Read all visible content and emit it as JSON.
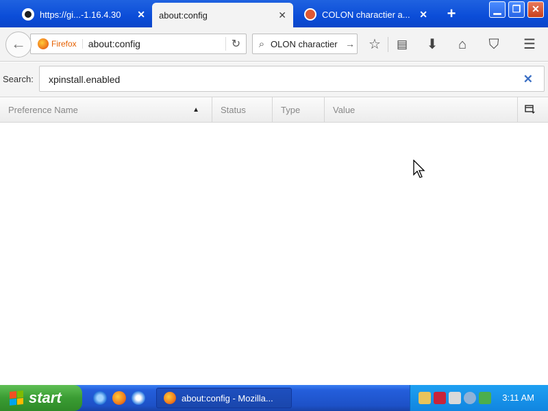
{
  "tabs": [
    {
      "label": "https://gi...-1.16.4.30",
      "icon": "github-icon",
      "close": "✕"
    },
    {
      "label": "about:config",
      "close": "✕"
    },
    {
      "label": "COLON charactier a...",
      "icon": "duckduckgo-icon",
      "close": "✕"
    }
  ],
  "newtab": "+",
  "window_buttons": {
    "minimize": "▁",
    "maximize": "❐",
    "close": "✕"
  },
  "navbar": {
    "back": "←",
    "identity_label": "Firefox",
    "url": "about:config",
    "reload": "↻",
    "search_text": "OLON charactier",
    "search_glyph": "⌕",
    "search_go": "→",
    "icons": [
      "star-icon",
      "reading-list-icon",
      "download-icon",
      "home-icon",
      "pocket-icon",
      "menu-icon"
    ]
  },
  "config": {
    "search_label": "Search:",
    "search_value": "xpinstall.enabled",
    "clear": "✕",
    "columns": {
      "name": "Preference Name",
      "status": "Status",
      "type": "Type",
      "value": "Value"
    },
    "sort_indicator": "▲"
  },
  "taskbar": {
    "start_label": "start",
    "task_label": "about:config - Mozilla...",
    "clock": "3:11 AM"
  }
}
